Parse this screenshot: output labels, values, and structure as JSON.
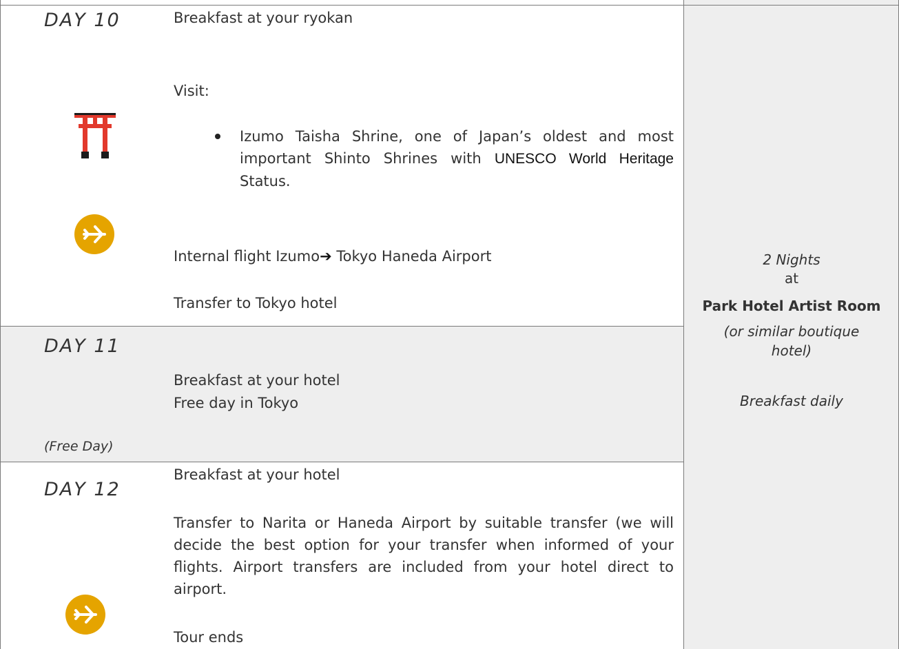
{
  "day10": {
    "label": "DAY 10",
    "breakfast": "Breakfast at your ryokan",
    "visit_label": "Visit:",
    "bullet_text": "Izumo Taisha Shrine, one of Japan’s oldest and most important Shinto Shrines with",
    "bullet_highlight": "UNESCO World Heritage",
    "bullet_end": "Status.",
    "flight_from": "Internal flight Izumo",
    "flight_to": " Tokyo Haneda Airport",
    "transfer": "Transfer to Tokyo hotel"
  },
  "day11": {
    "label": "DAY 11",
    "breakfast": "Breakfast at your hotel",
    "activity": "Free day in Tokyo",
    "note": "(Free Day)"
  },
  "day12": {
    "label": "DAY 12",
    "breakfast": "Breakfast at your hotel",
    "transfer_text": "Transfer to Narita or Haneda Airport by suitable transfer (we will decide the best option for your transfer when informed of your flights. Airport transfers are included from your hotel direct to airport.",
    "end": "Tour ends"
  },
  "accommodation": {
    "nights": "2 Nights",
    "at": "at",
    "hotel": "Park Hotel Artist Room",
    "alternative": "(or similar boutique hotel)",
    "meals": "Breakfast daily"
  },
  "icons": [
    "torii-gate-icon",
    "airplane-icon",
    "airplane-icon"
  ],
  "colors": {
    "plane_circle": "#e5a400",
    "torii": "#e2392c",
    "grey_row": "#eeeeee"
  }
}
